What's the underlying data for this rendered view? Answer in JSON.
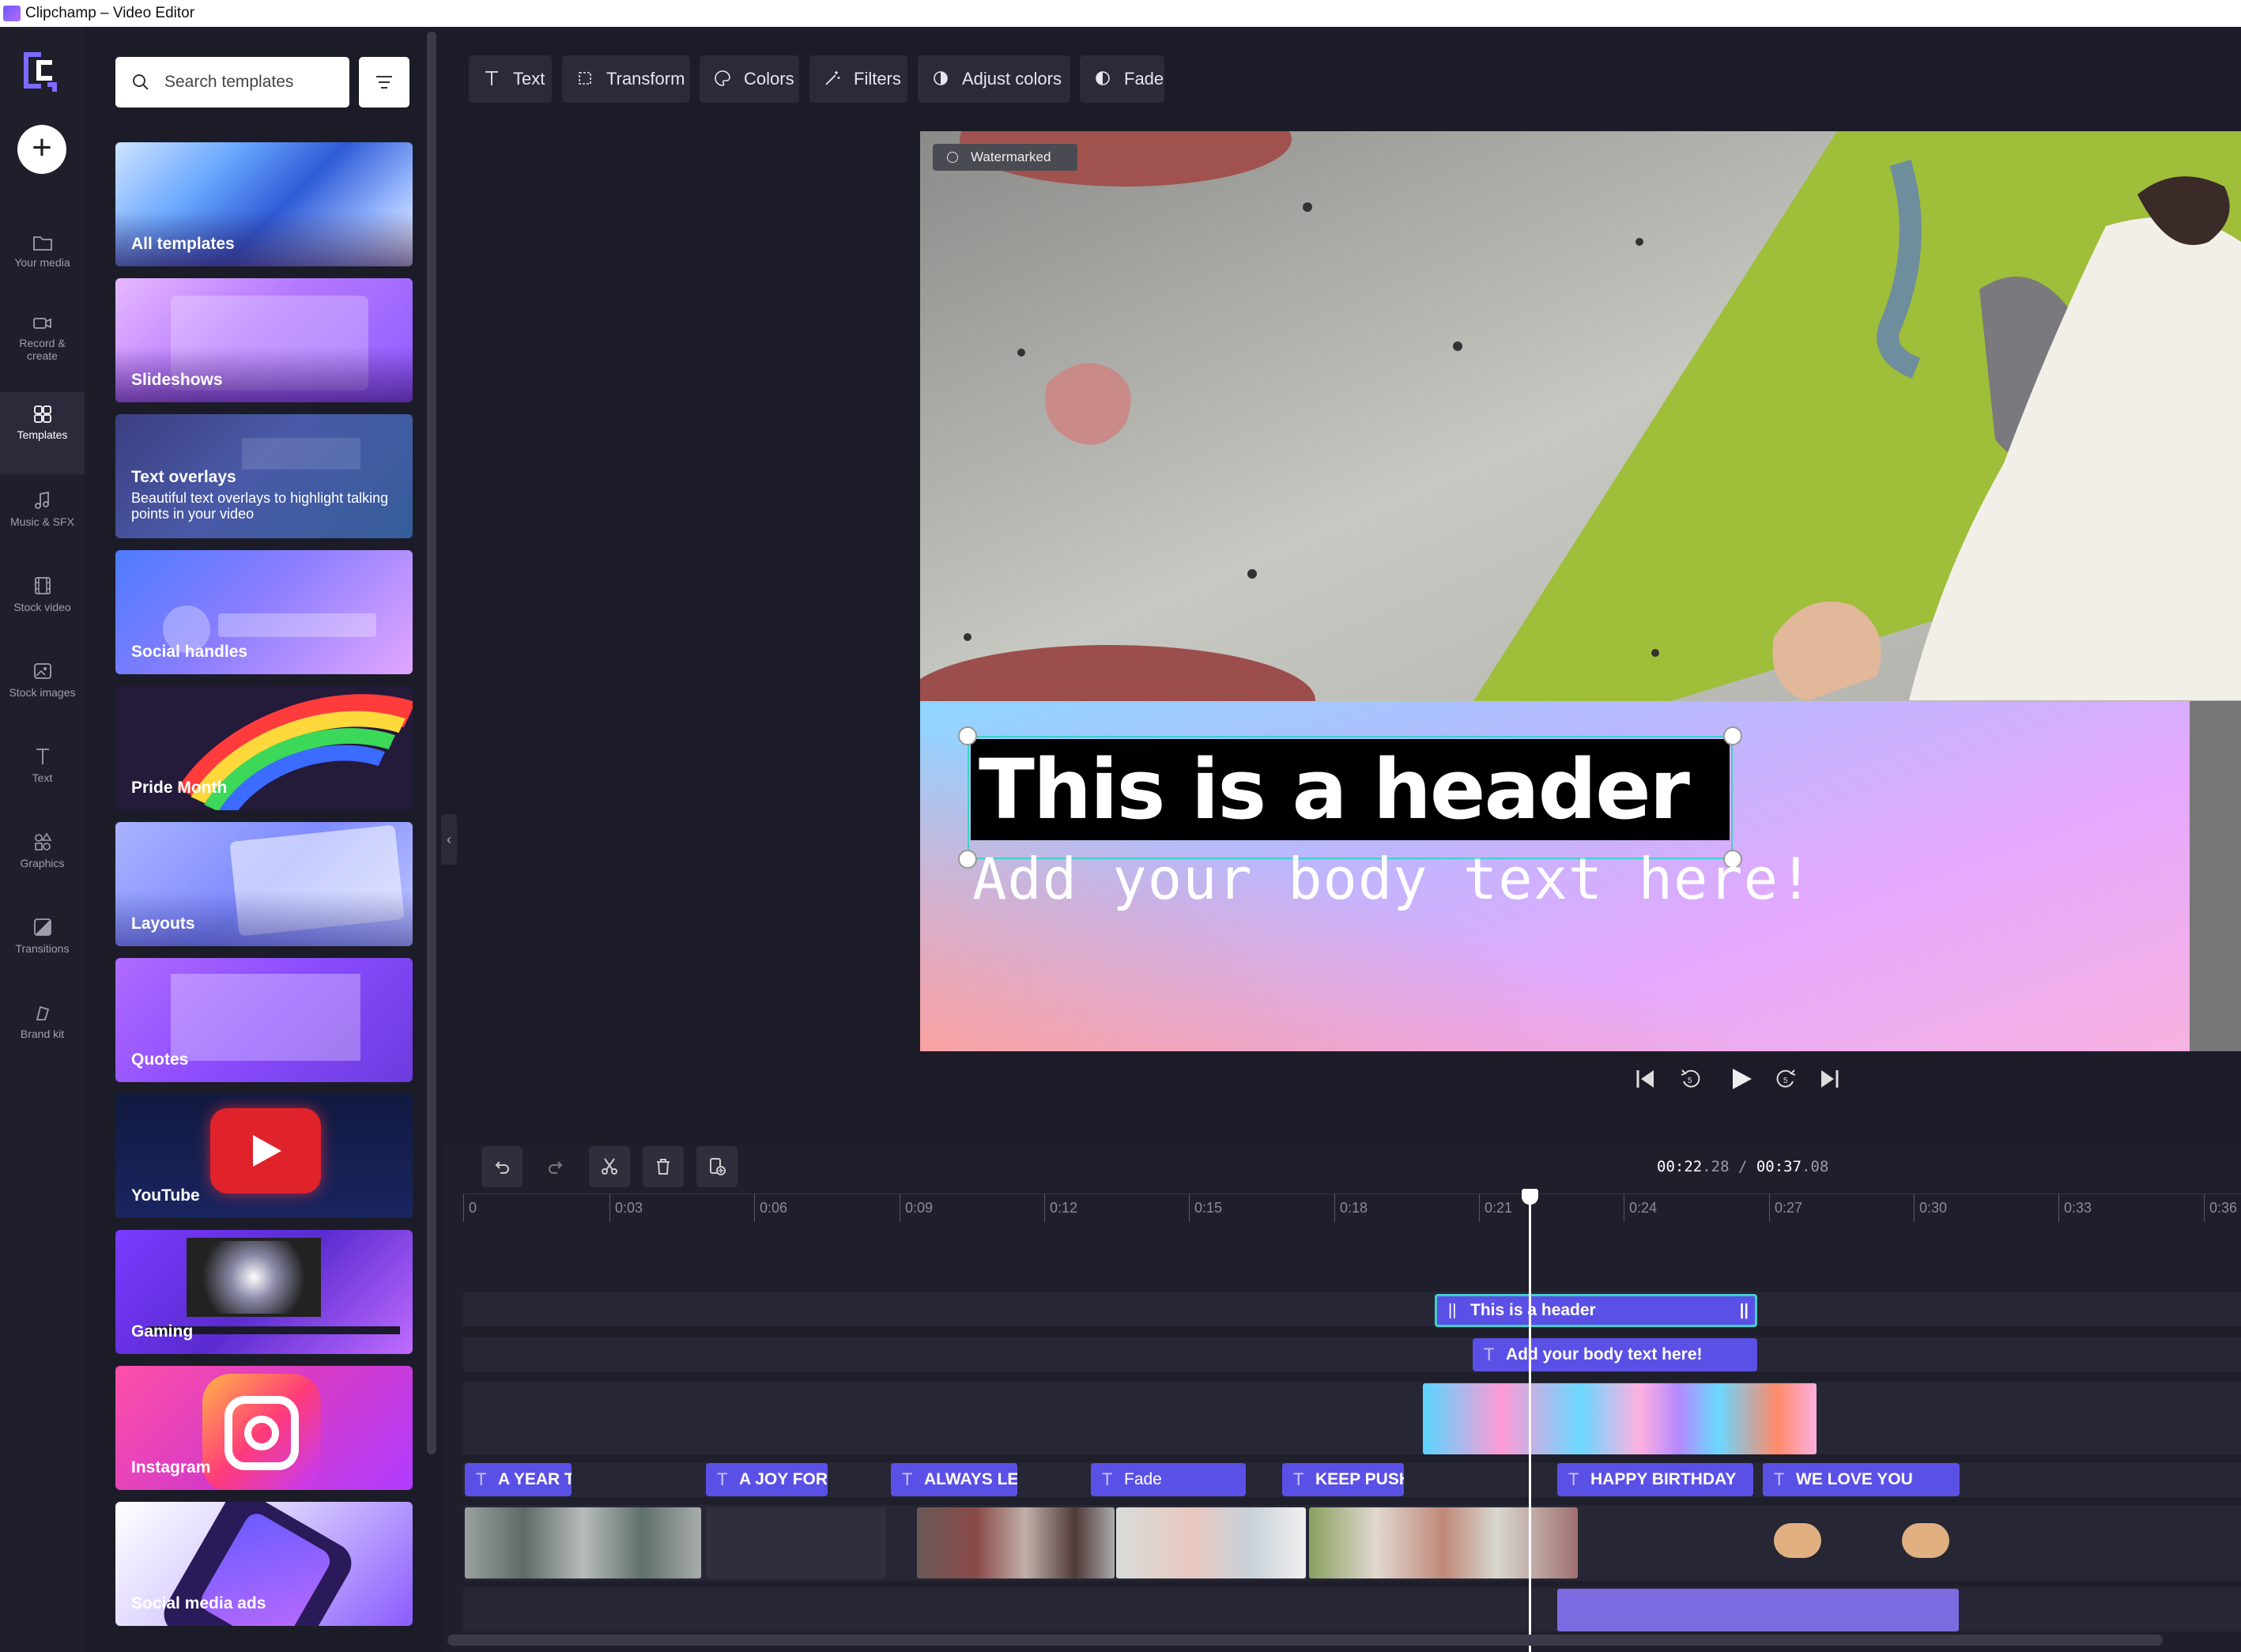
{
  "window": {
    "title": "Clipchamp – Video Editor"
  },
  "rail": {
    "items": [
      {
        "id": "your-media",
        "label": "Your media"
      },
      {
        "id": "record-create",
        "label": "Record & create"
      },
      {
        "id": "templates",
        "label": "Templates"
      },
      {
        "id": "music-sfx",
        "label": "Music & SFX"
      },
      {
        "id": "stock-video",
        "label": "Stock video"
      },
      {
        "id": "stock-images",
        "label": "Stock images"
      },
      {
        "id": "text",
        "label": "Text"
      },
      {
        "id": "graphics",
        "label": "Graphics"
      },
      {
        "id": "transitions",
        "label": "Transitions"
      },
      {
        "id": "brand-kit",
        "label": "Brand kit"
      }
    ],
    "active": "templates"
  },
  "panel": {
    "search_placeholder": "Search templates",
    "cards": [
      {
        "title": "All templates"
      },
      {
        "title": "Slideshows"
      },
      {
        "title": "Text overlays",
        "desc": "Beautiful text overlays to highlight talking points in your video"
      },
      {
        "title": "Social handles"
      },
      {
        "title": "Pride Month"
      },
      {
        "title": "Layouts"
      },
      {
        "title": "Quotes"
      },
      {
        "title": "YouTube"
      },
      {
        "title": "Gaming"
      },
      {
        "title": "Instagram"
      },
      {
        "title": "Social media ads"
      }
    ]
  },
  "toolbar": {
    "text": "Text",
    "transform": "Transform",
    "colors": "Colors",
    "filters": "Filters",
    "adjust_colors": "Adjust colors",
    "fade": "Fade"
  },
  "preview": {
    "watermark": "Watermarked",
    "header": "This is a header",
    "body": "Add your body text here!"
  },
  "timeline": {
    "time_current_main": "00:22",
    "time_current_frac": ".28",
    "separator": " / ",
    "time_total_main": "00:37",
    "time_total_frac": ".08",
    "ticks": [
      "0",
      "0:03",
      "0:06",
      "0:09",
      "0:12",
      "0:15",
      "0:18",
      "0:21",
      "0:24",
      "0:27",
      "0:30",
      "0:33",
      "0:36"
    ],
    "text_clips": {
      "header": "This is a header",
      "body": "Add your body text here!"
    },
    "title_clips": [
      "A YEAR TO",
      "A JOY FOR I",
      "ALWAYS LEA",
      "Fade",
      "KEEP PUSHI",
      "HAPPY BIRTHDAY",
      "WE LOVE YOU"
    ]
  },
  "colors": {
    "accent": "#5b50e6",
    "selection": "#3fd0c8",
    "background": "#1c1c28"
  }
}
